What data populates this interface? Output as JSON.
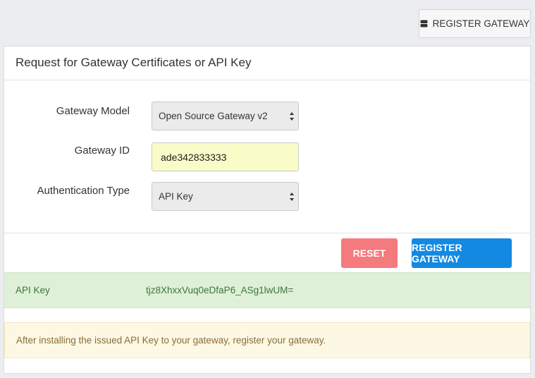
{
  "header": {
    "register_button_label": "REGISTER GATEWAY",
    "register_icon": "server-icon"
  },
  "panel": {
    "title": "Request for Gateway Certificates or API Key"
  },
  "form": {
    "gateway_model": {
      "label": "Gateway Model",
      "value": "Open Source Gateway v2"
    },
    "gateway_id": {
      "label": "Gateway ID",
      "value": "ade342833333"
    },
    "auth_type": {
      "label": "Authentication Type",
      "value": "API Key"
    }
  },
  "actions": {
    "reset_label": "RESET",
    "register_label": "REGISTER GATEWAY"
  },
  "result": {
    "key_label": "API Key",
    "key_value": "tjz8XhxxVuq0eDfaP6_ASg1lwUM="
  },
  "notice": {
    "text": "After installing the issued API Key to your gateway, register your gateway."
  },
  "colors": {
    "primary": "#1389e2",
    "danger": "#f47a7d",
    "success_bg": "#dff0d8",
    "warning_bg": "#fcf8e3",
    "input_highlight": "#fafcc8"
  }
}
